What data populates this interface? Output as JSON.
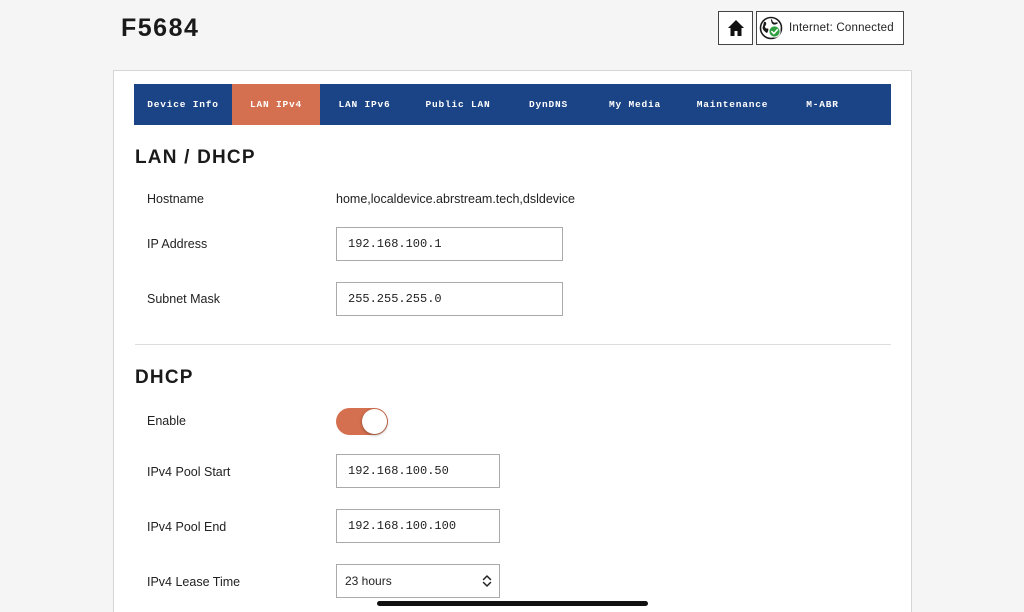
{
  "header": {
    "device_name": "F5684",
    "home_icon": "home-icon",
    "internet_status": "Internet: Connected",
    "globe_icon": "globe-check-icon"
  },
  "nav": {
    "tabs": [
      {
        "label": "Device Info",
        "active": false
      },
      {
        "label": "LAN IPv4",
        "active": true
      },
      {
        "label": "LAN IPv6",
        "active": false
      },
      {
        "label": "Public LAN",
        "active": false
      },
      {
        "label": "DynDNS",
        "active": false
      },
      {
        "label": "My Media",
        "active": false
      },
      {
        "label": "Maintenance",
        "active": false
      },
      {
        "label": "M-ABR",
        "active": false
      }
    ]
  },
  "lan": {
    "title": "LAN / DHCP",
    "hostname_label": "Hostname",
    "hostname_value": "home,localdevice.abrstream.tech,dsldevice",
    "ip_label": "IP Address",
    "ip_value": "192.168.100.1",
    "mask_label": "Subnet Mask",
    "mask_value": "255.255.255.0"
  },
  "dhcp": {
    "title": "DHCP",
    "enable_label": "Enable",
    "enabled": true,
    "pool_start_label": "IPv4 Pool Start",
    "pool_start_value": "192.168.100.50",
    "pool_end_label": "IPv4 Pool End",
    "pool_end_value": "192.168.100.100",
    "lease_label": "IPv4 Lease Time",
    "lease_value": "23 hours"
  },
  "colors": {
    "nav_bg": "#1b4486",
    "accent": "#d4704f",
    "status_green": "#2e9e3e"
  }
}
